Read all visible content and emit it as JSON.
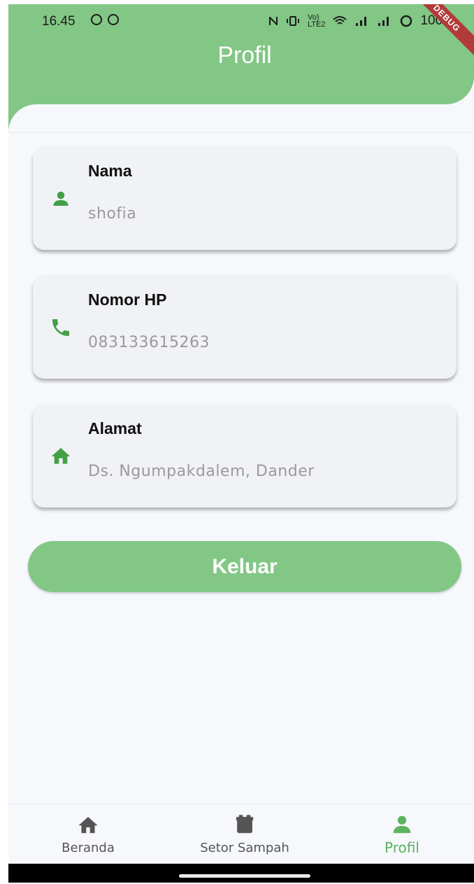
{
  "status_bar": {
    "time": "16.45",
    "network_label_top": "Vo)",
    "network_label_bottom": "LTE2",
    "battery": "100",
    "debug_label": "DEBUG"
  },
  "header": {
    "title": "Profil"
  },
  "profile": {
    "fields": [
      {
        "label": "Nama",
        "value": "shofia",
        "icon": "person-icon"
      },
      {
        "label": "Nomor HP",
        "value": "083133615263",
        "icon": "phone-icon"
      },
      {
        "label": "Alamat",
        "value": "Ds. Ngumpakdalem, Dander",
        "icon": "home-icon"
      }
    ]
  },
  "actions": {
    "logout_label": "Keluar"
  },
  "bottom_nav": {
    "items": [
      {
        "label": "Beranda",
        "icon": "home-icon",
        "active": false
      },
      {
        "label": "Setor Sampah",
        "icon": "trash-bin-icon",
        "active": false
      },
      {
        "label": "Profil",
        "icon": "person-icon",
        "active": true
      }
    ]
  },
  "colors": {
    "primary": "#82c785",
    "icon_green": "#43a047",
    "active_nav": "#5cb360",
    "inactive_nav": "#555555",
    "value_gray": "#9a9a9a"
  }
}
